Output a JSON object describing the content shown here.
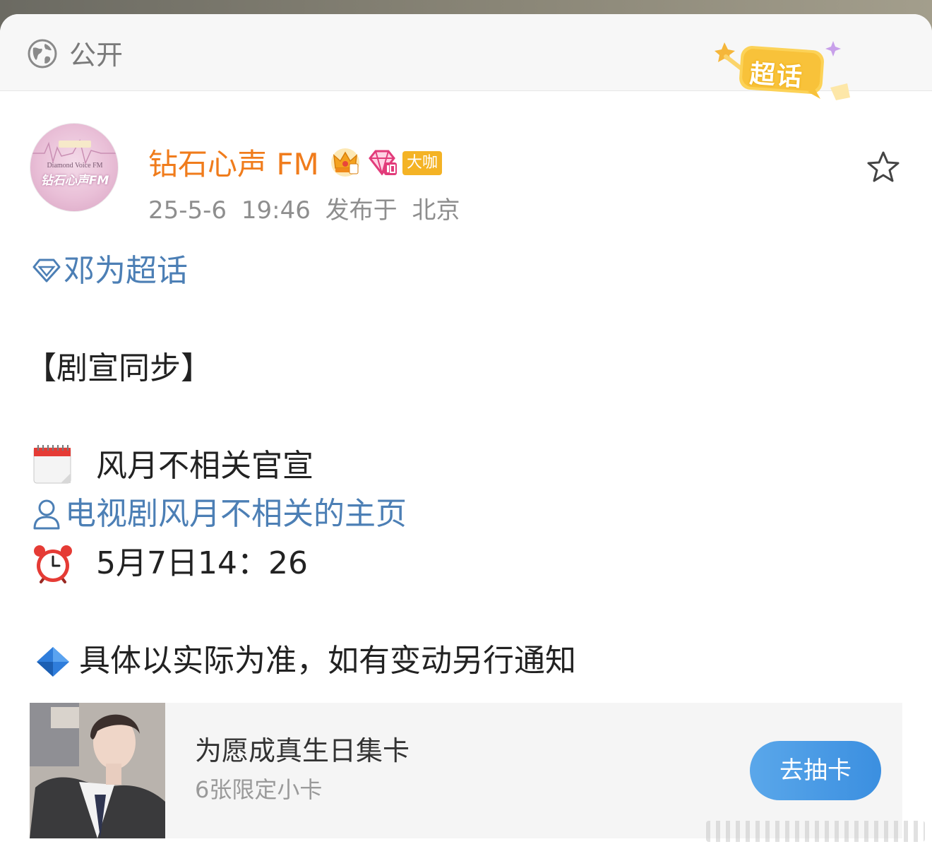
{
  "header": {
    "visibility_label": "公开",
    "badge_text": "超话"
  },
  "post": {
    "avatar_line1": "Diamond Voice FM",
    "avatar_line2": "钻石心声FM",
    "username": "钻石心声 FM",
    "level_badge": "大咖",
    "meta": "25-5-6 19:46  发布于 北京",
    "topic": "邓为超话",
    "lines": [
      "【剧宣同步】",
      "风月不相关官宣",
      "电视剧风月不相关的主页",
      "5月7日14：26",
      "具体以实际为准，如有变动另行通知"
    ]
  },
  "promo": {
    "title": "为愿成真生日集卡",
    "subtitle": "6张限定小卡",
    "button_label": "去抽卡"
  },
  "colors": {
    "username": "#f07c1c",
    "link": "#4c7fb5",
    "button": "#3b8fe0",
    "badge": "#f4b325"
  },
  "icons": [
    "globe-icon",
    "crown-icon",
    "diamond-badge-icon",
    "star-icon",
    "diamond-icon",
    "calendar-icon",
    "user-icon",
    "alarm-clock-icon",
    "blue-diamond-icon"
  ]
}
